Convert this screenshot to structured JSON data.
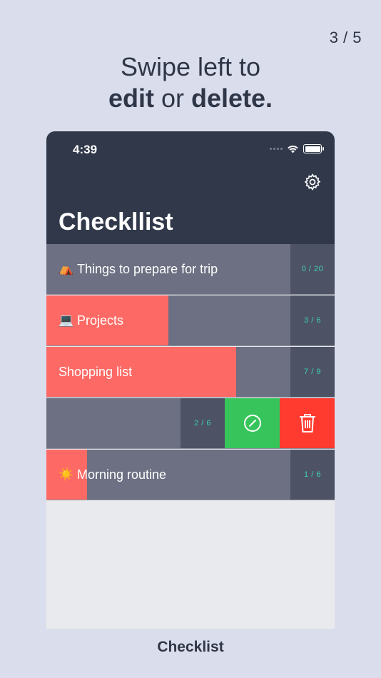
{
  "page_counter": "3 / 5",
  "headline": {
    "line1": "Swipe left to",
    "line2_a": "edit",
    "line2_b": " or ",
    "line2_c": "delete."
  },
  "status_bar": {
    "time": "4:39"
  },
  "nav": {
    "title": "Checkllist",
    "settings_icon": "gear-icon"
  },
  "lists": [
    {
      "emoji": "⛺",
      "name": "Things to prepare for trip",
      "count": "0 / 20",
      "progress": 0
    },
    {
      "emoji": "💻",
      "name": "Projects",
      "count": "3 / 6",
      "progress": 0.5
    },
    {
      "emoji": "",
      "name": "Shopping list",
      "count": "7 / 9",
      "progress": 0.78
    },
    {
      "emoji": "",
      "name": "",
      "count": "2 / 6",
      "progress": 0.33,
      "swiped": true
    },
    {
      "emoji": "☀️",
      "name": "Morning routine",
      "count": "1 / 6",
      "progress": 0.17
    }
  ],
  "swipe_actions": {
    "edit_icon": "edit-icon",
    "delete_icon": "trash-icon"
  },
  "app_name": "Checklist",
  "colors": {
    "background": "#dadeec",
    "nav": "#30384a",
    "row": "#6c7082",
    "progress": "#fd6a65",
    "count_box": "#4d5264",
    "count_text": "#3fd0b0",
    "edit": "#37c55b",
    "delete": "#ff3b30"
  }
}
